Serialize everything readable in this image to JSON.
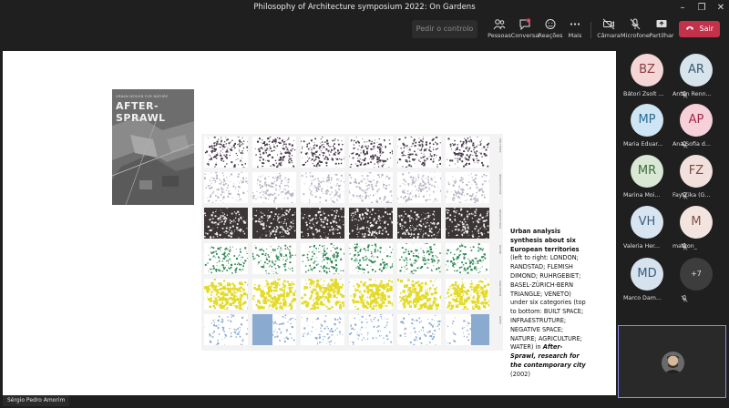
{
  "window": {
    "title": "Philosophy of Architecture symposium 2022: On Gardens"
  },
  "toolbar": {
    "control_label": "Pedir o controlo",
    "people_label": "Pessoas",
    "chat_label": "Conversa",
    "reactions_label": "Reações",
    "more_label": "Mais",
    "camera_label": "Câmara",
    "mic_label": "Microfone",
    "share_label": "Partilhar",
    "leave_label": "Sair",
    "chat_badge": "1"
  },
  "slide": {
    "book_series": "URBAN DESIGN FOR NATURE",
    "book_title": "AFTER-SPRAWL",
    "caption_bold": "Urban analysis synthesis about six European territories",
    "caption_text1": " (left to right: LONDON; RANDSTAD; FLEMISH DIMOND; RUHRGEBIET; BASEL-ZÜRICH-BERN TRIANGLE; VENETO) under six categories (top to bottom: BUILT SPACE; INFRAESTRUTURE; NEGATIVE SPACE; NATURE; AGRICULTURE; WATER) in ",
    "caption_italic": "After-Sprawl, research for the contemporary city",
    "caption_text2": " (2002)",
    "row_labels": [
      "BUILT SPACE",
      "INFRASTRUCTURE",
      "NEGATIVE SPACE",
      "NATURE",
      "AGRICULTURE",
      "WATER"
    ],
    "colors": {
      "built": "#4a3c4c",
      "infra": "#b9b4c4",
      "negative": "#3b3536",
      "nature": "#2f8a55",
      "agri": "#e3da2a",
      "water": "#8aaad0"
    }
  },
  "presenter": {
    "name": "Sérgio Pedro Amorim"
  },
  "participants": [
    {
      "initials": "BZ",
      "name": "Bátori Zsolt ...",
      "bg": "#f4d6d6",
      "fg": "#8a3c3c"
    },
    {
      "initials": "AR",
      "name": "Anton Renn...",
      "bg": "#d7e4ec",
      "fg": "#3a5a70"
    },
    {
      "initials": "MP",
      "name": "Maria Eduar...",
      "bg": "#cfe5f3",
      "fg": "#2d6a92"
    },
    {
      "initials": "AP",
      "name": "Ana Sofia d...",
      "bg": "#f7d1da",
      "fg": "#a32a4a"
    },
    {
      "initials": "MR",
      "name": "Marina Moi...",
      "bg": "#d9e8d4",
      "fg": "#3d6b3a"
    },
    {
      "initials": "FZ",
      "name": "Fay Zika (G...",
      "bg": "#f2e0dc",
      "fg": "#7a4a42"
    },
    {
      "initials": "VH",
      "name": "Valeria Her...",
      "bg": "#d8e4f0",
      "fg": "#3f5f80"
    },
    {
      "initials": "M",
      "name": "matkon_",
      "bg": "#f3e4e0",
      "fg": "#7c5248"
    },
    {
      "initials": "MD",
      "name": "Marco Dam...",
      "bg": "#d6e2ee",
      "fg": "#3b5a7a"
    }
  ],
  "overflow": {
    "label": "+7"
  }
}
